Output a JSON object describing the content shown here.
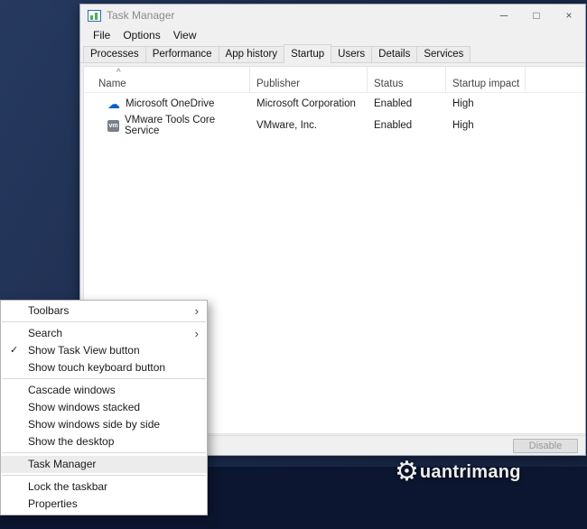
{
  "window": {
    "title": "Task Manager",
    "controls": {
      "minimize": "─",
      "maximize": "□",
      "close": "×"
    },
    "menu": {
      "file": "File",
      "options": "Options",
      "view": "View"
    },
    "tabs": [
      {
        "label": "Processes"
      },
      {
        "label": "Performance"
      },
      {
        "label": "App history"
      },
      {
        "label": "Startup"
      },
      {
        "label": "Users"
      },
      {
        "label": "Details"
      },
      {
        "label": "Services"
      }
    ],
    "active_tab": "Startup",
    "columns": {
      "name": "Name",
      "publisher": "Publisher",
      "status": "Status",
      "impact": "Startup impact"
    },
    "sort": {
      "column": "Name",
      "direction": "ascending"
    },
    "rows": [
      {
        "name": "Microsoft OneDrive",
        "icon": "onedrive-cloud-icon",
        "icon_glyph": "☁",
        "publisher": "Microsoft Corporation",
        "status": "Enabled",
        "impact": "High"
      },
      {
        "name": "VMware Tools Core Service",
        "icon": "vmware-icon",
        "icon_text": "vm",
        "publisher": "VMware, Inc.",
        "status": "Enabled",
        "impact": "High"
      }
    ],
    "footer": {
      "disable_label": "Disable"
    }
  },
  "glyphs": {
    "check": "✓",
    "submenu_arrow": "›",
    "sort_ascending": "^"
  },
  "context_menu": {
    "toolbars": "Toolbars",
    "search": "Search",
    "show_task_view": "Show Task View button",
    "show_touch_keyboard": "Show touch keyboard button",
    "cascade": "Cascade windows",
    "stacked": "Show windows stacked",
    "side_by_side": "Show windows side by side",
    "show_desktop": "Show the desktop",
    "task_manager": "Task Manager",
    "lock_taskbar": "Lock the taskbar",
    "properties": "Properties",
    "highlighted": "Task Manager"
  },
  "watermark": {
    "icon_glyph": "⚙",
    "text": "uantrimang"
  },
  "colors": {
    "onedrive_blue": "#0b64c4",
    "desktop_navy": "#1b2a4a",
    "taskbar_dark": "#0d1630"
  }
}
